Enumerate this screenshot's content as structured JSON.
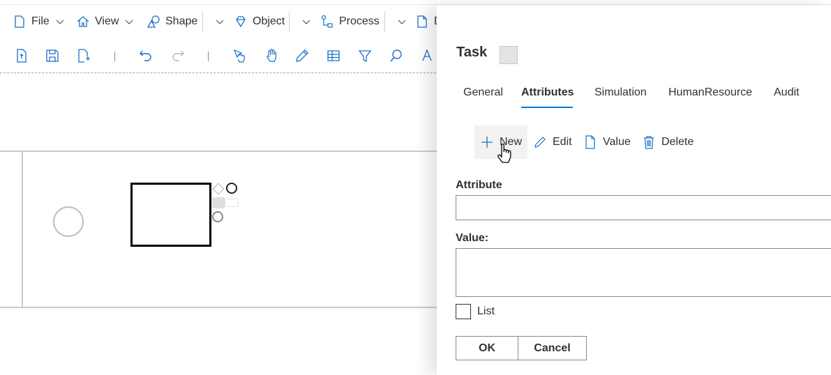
{
  "menu": {
    "items": [
      {
        "label": "File",
        "icon": "file-icon"
      },
      {
        "label": "View",
        "icon": "home-icon"
      },
      {
        "label": "Shape",
        "icon": "shapes-icon"
      },
      {
        "label": "Object",
        "icon": "diamond-icon"
      },
      {
        "label": "Process",
        "icon": "process-icon"
      },
      {
        "label": "D",
        "icon": "document-icon"
      }
    ]
  },
  "toolbar": {
    "icons": [
      "new-file-icon",
      "save-icon",
      "add-page-icon",
      "undo-icon",
      "redo-icon",
      "pointer-hand-icon",
      "pan-hand-icon",
      "pencil-icon",
      "grid-icon",
      "filter-icon",
      "search-icon",
      "format-icon"
    ]
  },
  "panel": {
    "title": "Task",
    "tabs": [
      "General",
      "Attributes",
      "Simulation",
      "HumanResource",
      "Audit"
    ],
    "active_tab": "Attributes",
    "commands": {
      "new": "New",
      "edit": "Edit",
      "value": "Value",
      "delete": "Delete"
    },
    "attribute_label": "Attribute",
    "attribute_value": "",
    "value_label": "Value:",
    "value_text": "",
    "list_label": "List",
    "list_checked": false,
    "ok_label": "OK",
    "cancel_label": "Cancel"
  },
  "colors": {
    "accent": "#0078d4",
    "icon_blue": "#1a6fc9"
  }
}
